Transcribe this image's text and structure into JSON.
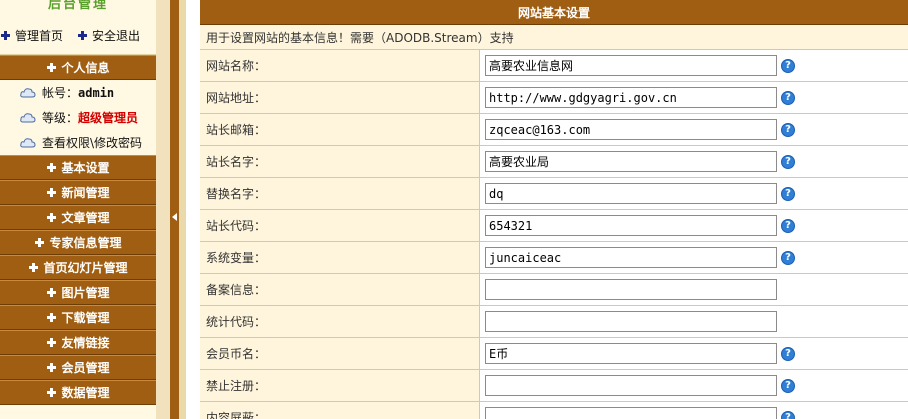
{
  "sidebar": {
    "logo_text": "后台管理",
    "top_links": [
      {
        "label": "管理首页"
      },
      {
        "label": "安全退出"
      }
    ],
    "personal_header": "个人信息",
    "info": {
      "account_label": "帐号：",
      "account_value": "admin",
      "level_label": "等级：",
      "level_value": "超级管理员",
      "perm_link": "查看权限\\修改密码"
    },
    "menu": [
      {
        "label": "基本设置"
      },
      {
        "label": "新闻管理"
      },
      {
        "label": "文章管理"
      },
      {
        "label": "专家信息管理"
      },
      {
        "label": "首页幻灯片管理"
      },
      {
        "label": "图片管理"
      },
      {
        "label": "下载管理"
      },
      {
        "label": "友情链接"
      },
      {
        "label": "会员管理"
      },
      {
        "label": "数据管理"
      }
    ]
  },
  "main": {
    "title": "网站基本设置",
    "subtitle": "用于设置网站的基本信息！需要（ADODB.Stream）支持",
    "help_glyph": "?",
    "fields": [
      {
        "label": "网站名称：",
        "value": "高要农业信息网",
        "help": true
      },
      {
        "label": "网站地址：",
        "value": "http://www.gdgyagri.gov.cn",
        "help": true
      },
      {
        "label": "站长邮箱：",
        "value": "zqceac@163.com",
        "help": true
      },
      {
        "label": "站长名字：",
        "value": "高要农业局",
        "help": true
      },
      {
        "label": "替换名字：",
        "value": "dq",
        "help": true
      },
      {
        "label": "站长代码：",
        "value": "654321",
        "help": true
      },
      {
        "label": "系统变量：",
        "value": "juncaiceac",
        "help": true
      },
      {
        "label": "备案信息：",
        "value": "",
        "help": false
      },
      {
        "label": "统计代码：",
        "value": "",
        "help": false
      },
      {
        "label": "会员币名：",
        "value": "E币",
        "help": true
      },
      {
        "label": "禁止注册：",
        "value": "",
        "help": true
      },
      {
        "label": "内容屏蔽：",
        "value": "",
        "help": true
      }
    ]
  },
  "colors": {
    "menu_brown": "#a05e13",
    "panel_cream": "#fff5dc",
    "help_blue": "#2f7fd6",
    "level_red": "#d40000"
  }
}
